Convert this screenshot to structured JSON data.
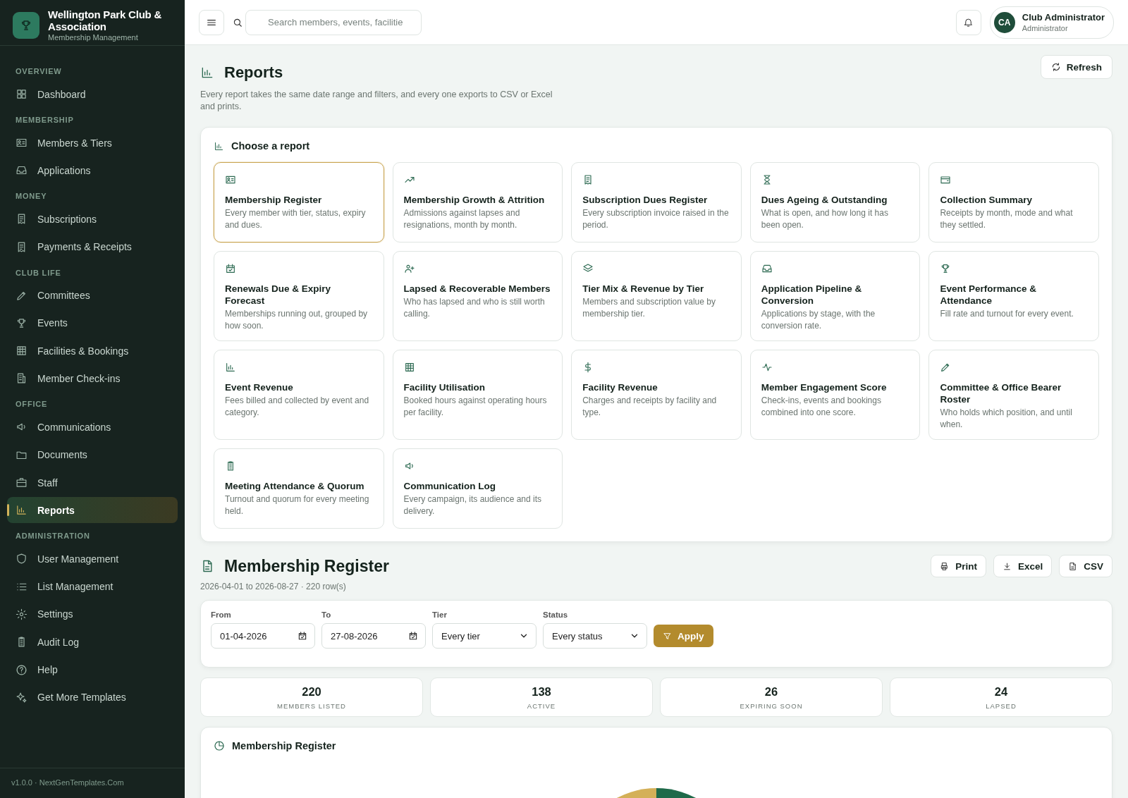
{
  "brand": {
    "name": "Wellington Park Club & Association",
    "subtitle": "Membership Management"
  },
  "sidebar": {
    "sections": [
      {
        "title": "OVERVIEW",
        "items": [
          {
            "label": "Dashboard",
            "selected": false
          }
        ]
      },
      {
        "title": "MEMBERSHIP",
        "items": [
          {
            "label": "Members & Tiers",
            "selected": false
          },
          {
            "label": "Applications",
            "selected": false
          }
        ]
      },
      {
        "title": "MONEY",
        "items": [
          {
            "label": "Subscriptions",
            "selected": false
          },
          {
            "label": "Payments & Receipts",
            "selected": false
          }
        ]
      },
      {
        "title": "CLUB LIFE",
        "items": [
          {
            "label": "Committees",
            "selected": false
          },
          {
            "label": "Events",
            "selected": false
          },
          {
            "label": "Facilities & Bookings",
            "selected": false
          },
          {
            "label": "Member Check-ins",
            "selected": false
          }
        ]
      },
      {
        "title": "OFFICE",
        "items": [
          {
            "label": "Communications",
            "selected": false
          },
          {
            "label": "Documents",
            "selected": false
          },
          {
            "label": "Staff",
            "selected": false
          },
          {
            "label": "Reports",
            "selected": true
          }
        ]
      },
      {
        "title": "ADMINISTRATION",
        "items": [
          {
            "label": "User Management",
            "selected": false
          },
          {
            "label": "List Management",
            "selected": false
          },
          {
            "label": "Settings",
            "selected": false
          },
          {
            "label": "Audit Log",
            "selected": false
          },
          {
            "label": "Help",
            "selected": false
          },
          {
            "label": "Get More Templates",
            "selected": false
          }
        ]
      }
    ],
    "footer": "v1.0.0 · NextGenTemplates.Com"
  },
  "header": {
    "search": {
      "placeholder": "Search members, events, facilitie"
    },
    "user": {
      "initials": "CA",
      "name": "Club Administrator",
      "role": "Administrator"
    }
  },
  "page": {
    "title": "Reports",
    "description": "Every report takes the same date range and filters, and every one exports to CSV or Excel and prints.",
    "refresh": "Refresh"
  },
  "picker": {
    "title": "Choose a report",
    "reports": [
      {
        "title": "Membership Register",
        "description": "Every member with tier, status, expiry and dues.",
        "selected": true
      },
      {
        "title": "Membership Growth & Attrition",
        "description": "Admissions against lapses and resignations, month by month.",
        "selected": false
      },
      {
        "title": "Subscription Dues Register",
        "description": "Every subscription invoice raised in the period.",
        "selected": false
      },
      {
        "title": "Dues Ageing & Outstanding",
        "description": "What is open, and how long it has been open.",
        "selected": false
      },
      {
        "title": "Collection Summary",
        "description": "Receipts by month, mode and what they settled.",
        "selected": false
      },
      {
        "title": "Renewals Due & Expiry Forecast",
        "description": "Memberships running out, grouped by how soon.",
        "selected": false
      },
      {
        "title": "Lapsed & Recoverable Members",
        "description": "Who has lapsed and who is still worth calling.",
        "selected": false
      },
      {
        "title": "Tier Mix & Revenue by Tier",
        "description": "Members and subscription value by membership tier.",
        "selected": false
      },
      {
        "title": "Application Pipeline & Conversion",
        "description": "Applications by stage, with the conversion rate.",
        "selected": false
      },
      {
        "title": "Event Performance & Attendance",
        "description": "Fill rate and turnout for every event.",
        "selected": false
      },
      {
        "title": "Event Revenue",
        "description": "Fees billed and collected by event and category.",
        "selected": false
      },
      {
        "title": "Facility Utilisation",
        "description": "Booked hours against operating hours per facility.",
        "selected": false
      },
      {
        "title": "Facility Revenue",
        "description": "Charges and receipts by facility and type.",
        "selected": false
      },
      {
        "title": "Member Engagement Score",
        "description": "Check-ins, events and bookings combined into one score.",
        "selected": false
      },
      {
        "title": "Committee & Office Bearer Roster",
        "description": "Who holds which position, and until when.",
        "selected": false
      },
      {
        "title": "Meeting Attendance & Quorum",
        "description": "Turnout and quorum for every meeting held.",
        "selected": false
      },
      {
        "title": "Communication Log",
        "description": "Every campaign, its audience and its delivery.",
        "selected": false
      }
    ]
  },
  "report": {
    "title": "Membership Register",
    "meta": "2026-04-01 to 2026-08-27 · 220 row(s)",
    "actions": [
      {
        "kind": "print",
        "label": "Print"
      },
      {
        "kind": "excel",
        "label": "Excel"
      },
      {
        "kind": "csv",
        "label": "CSV"
      }
    ],
    "filters": [
      {
        "kind": "date",
        "label": "From",
        "value": "01-04-2026"
      },
      {
        "kind": "date",
        "label": "To",
        "value": "27-08-2026"
      },
      {
        "kind": "select",
        "label": "Tier",
        "value": "Every tier"
      },
      {
        "kind": "select",
        "label": "Status",
        "value": "Every status"
      }
    ],
    "apply": "Apply",
    "stats": [
      {
        "value": "220",
        "label": "MEMBERS LISTED"
      },
      {
        "value": "138",
        "label": "ACTIVE"
      },
      {
        "value": "26",
        "label": "EXPIRING SOON"
      },
      {
        "value": "24",
        "label": "LAPSED"
      }
    ],
    "chart_card": {
      "title": "Membership Register"
    }
  }
}
